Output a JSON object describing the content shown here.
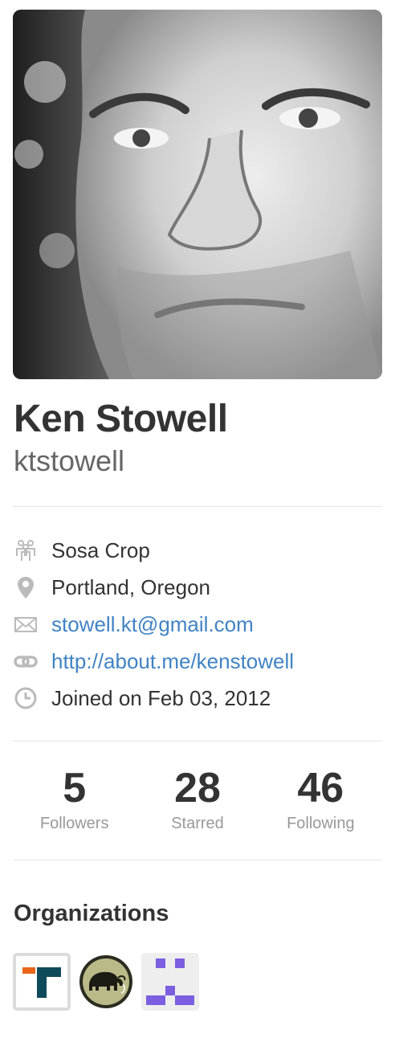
{
  "profile": {
    "fullname": "Ken Stowell",
    "username": "ktstowell"
  },
  "details": {
    "company": {
      "icon": "organization-icon",
      "text": "Sosa Crop"
    },
    "location": {
      "icon": "location-pin-icon",
      "text": "Portland, Oregon"
    },
    "email": {
      "icon": "mail-icon",
      "text": "stowell.kt@gmail.com"
    },
    "website": {
      "icon": "link-icon",
      "text": "http://about.me/kenstowell"
    },
    "joined": {
      "icon": "clock-icon",
      "text": "Joined on Feb 03, 2012"
    }
  },
  "stats": {
    "followers": {
      "count": "5",
      "label": "Followers"
    },
    "starred": {
      "count": "28",
      "label": "Starred"
    },
    "following": {
      "count": "46",
      "label": "Following"
    }
  },
  "organizations": {
    "title": "Organizations",
    "items": [
      {
        "icon": "org-r-logo-icon"
      },
      {
        "icon": "org-mammoth-logo-icon"
      },
      {
        "icon": "org-identicon-icon"
      }
    ]
  },
  "colors": {
    "link": "#4183c4",
    "text": "#333333",
    "muted": "#999999",
    "identicon": "#7b5fe0",
    "logo_orange": "#e8651a",
    "logo_teal": "#0e4a5a"
  }
}
